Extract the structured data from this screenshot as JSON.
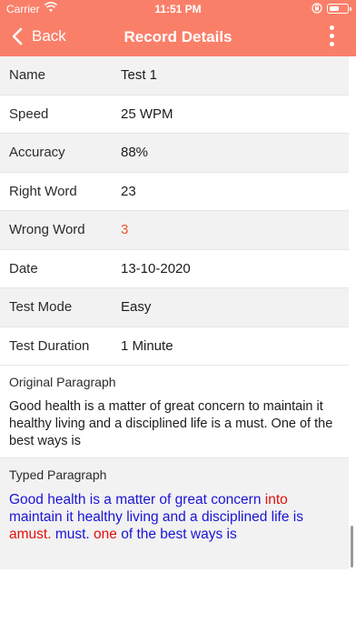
{
  "status_bar": {
    "carrier": "Carrier",
    "time": "11:51 PM"
  },
  "nav": {
    "back_label": "Back",
    "title": "Record Details"
  },
  "details": [
    {
      "label": "Name",
      "value": "Test 1"
    },
    {
      "label": "Speed",
      "value": "25 WPM"
    },
    {
      "label": "Accuracy",
      "value": "88%"
    },
    {
      "label": "Right Word",
      "value": "23"
    },
    {
      "label": "Wrong Word",
      "value": "3"
    },
    {
      "label": "Date",
      "value": "13-10-2020"
    },
    {
      "label": "Test Mode",
      "value": "Easy"
    },
    {
      "label": "Test Duration",
      "value": "1 Minute"
    }
  ],
  "original": {
    "title": "Original Paragraph",
    "text": "Good health is a matter of great concern to maintain it healthy living and a disciplined life is a must. One of the best ways is"
  },
  "typed": {
    "title": "Typed Paragraph",
    "segments": [
      {
        "text": "Good health is a matter of great concern ",
        "correct": true
      },
      {
        "text": "into",
        "correct": false
      },
      {
        "text": " maintain it healthy living and a disciplined life is ",
        "correct": true
      },
      {
        "text": "amust.",
        "correct": false
      },
      {
        "text": " must. ",
        "correct": true
      },
      {
        "text": "one",
        "correct": false
      },
      {
        "text": " of the best ways is",
        "correct": true
      }
    ]
  },
  "colors": {
    "header": "#fa7f69",
    "wrong_value": "#e8552f",
    "typed_correct": "#1a14d6",
    "typed_wrong": "#e20f0f",
    "alt_row": "#f2f2f2"
  }
}
